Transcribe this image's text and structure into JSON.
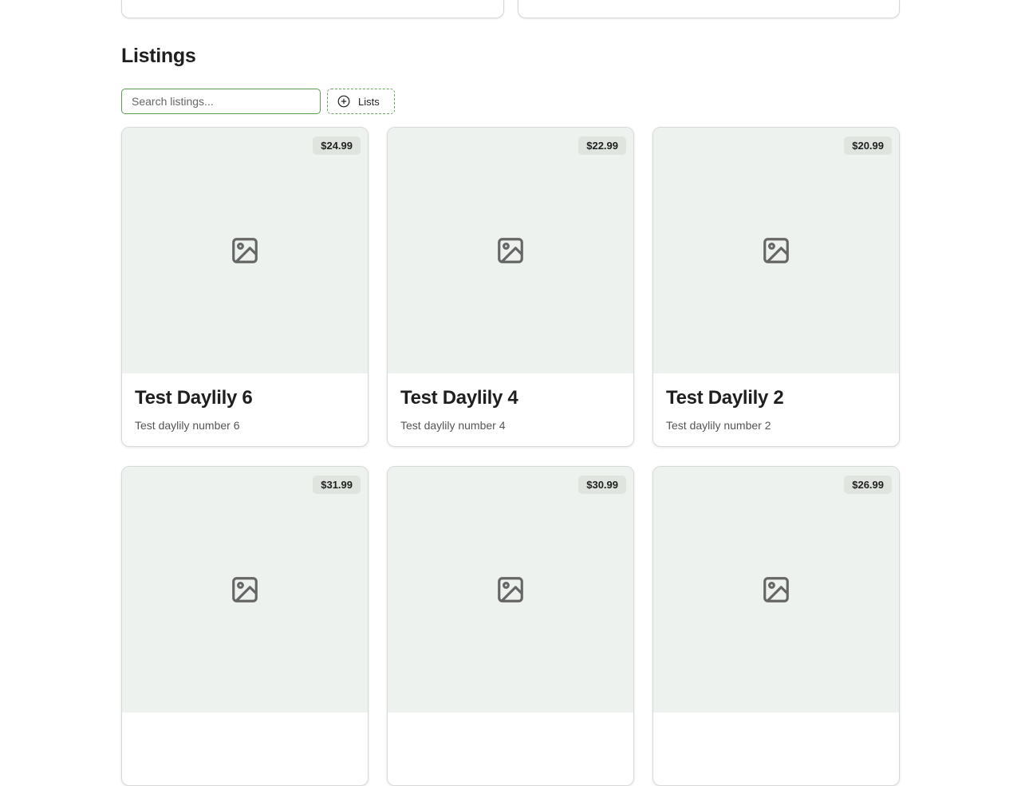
{
  "section": {
    "title": "Listings"
  },
  "toolbar": {
    "search_placeholder": "Search listings...",
    "search_value": "",
    "lists_label": "Lists"
  },
  "listings": [
    {
      "title": "Test Daylily 6",
      "description": "Test daylily number 6",
      "price": "$24.99"
    },
    {
      "title": "Test Daylily 4",
      "description": "Test daylily number 4",
      "price": "$22.99"
    },
    {
      "title": "Test Daylily 2",
      "description": "Test daylily number 2",
      "price": "$20.99"
    },
    {
      "title": "",
      "description": "",
      "price": "$31.99"
    },
    {
      "title": "",
      "description": "",
      "price": "$30.99"
    },
    {
      "title": "",
      "description": "",
      "price": "$26.99"
    }
  ],
  "icons": {
    "lists_button": "plus-circle-icon",
    "placeholder_image": "image-icon"
  },
  "colors": {
    "accent_green": "#5c9a4f",
    "image_bg": "#eef2ef",
    "badge_bg": "#dfe4df"
  }
}
